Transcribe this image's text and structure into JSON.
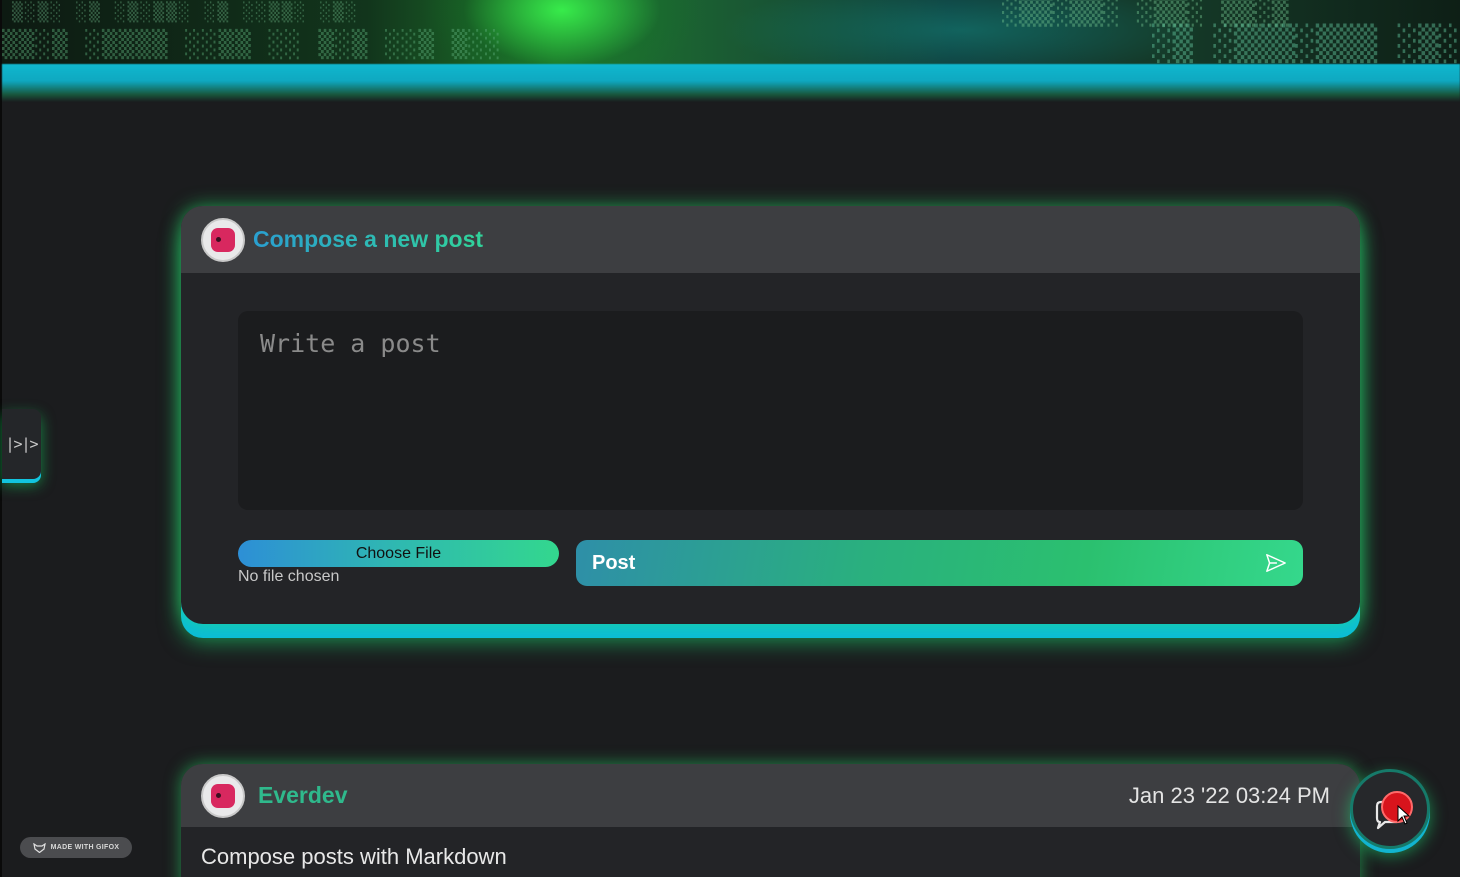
{
  "sidebar_toggle": {
    "label": "|>|>"
  },
  "compose": {
    "title": "Compose a new post",
    "textarea_placeholder": "Write a post",
    "file_button_label": "Choose File",
    "file_status": "No file chosen",
    "submit_label": "Post"
  },
  "posts": [
    {
      "author": "Everdev",
      "date": "Jan 23 '22 03:24 PM",
      "body": "Compose posts with Markdown"
    }
  ],
  "watermark": {
    "text": "MADE WITH GIFOX"
  },
  "icons": {
    "avatar": "robot-avatar-icon",
    "send": "send-icon",
    "chat": "chat-bubble-icon"
  },
  "colors": {
    "accent_teal": "#2dc4a0",
    "glow_cyan": "#0bbcd9",
    "glow_green": "#28e66e",
    "background": "#1b1c1e",
    "card": "#232427",
    "card_header": "#3d3e41"
  }
}
